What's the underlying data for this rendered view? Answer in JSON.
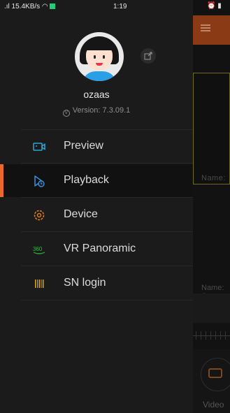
{
  "status_bar": {
    "left": ".ıl 15.4KB/s",
    "time": "1:19",
    "right": "⏰ ▮"
  },
  "background": {
    "name_label_1": "Name:",
    "name_label_2": "Name: C",
    "video_label": "Video"
  },
  "drawer": {
    "username": "ozaas",
    "version": "Version: 7.3.09.1",
    "menu": [
      {
        "label": "Preview",
        "icon": "preview-camera-icon",
        "color": "#2aa8d8"
      },
      {
        "label": "Playback",
        "icon": "playback-icon",
        "color": "#3b8fe0",
        "active": true
      },
      {
        "label": "Device",
        "icon": "device-gear-icon",
        "color": "#e07a20"
      },
      {
        "label": "VR Panoramic",
        "icon": "vr-360-icon",
        "color": "#2dbb3e"
      },
      {
        "label": "SN login",
        "icon": "barcode-icon",
        "color": "#d9a720"
      }
    ],
    "accent_color": "#e8692a"
  }
}
